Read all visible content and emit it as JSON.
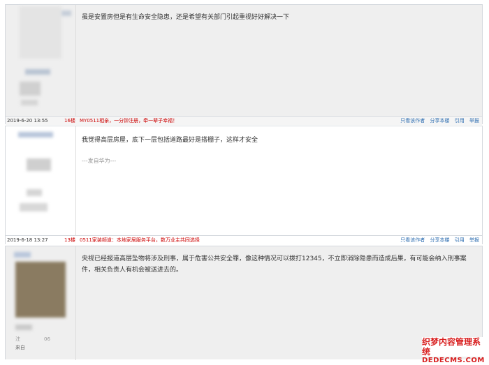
{
  "posts": [
    {
      "text": "虽是安置房但是有生命安全隐患，还是希望有关部门引起重视好好解决一下",
      "date": "2019-6-20 13:55",
      "floor": "16楼",
      "ad": "MY0511相亲，一分钟注册，牵一辈子幸福！",
      "actions": [
        "只看该作者",
        "分享本楼",
        "引用",
        "举报"
      ]
    },
    {
      "text": "我觉得高层房屋，底下一层包括道路最好是搭棚子，这样才安全",
      "via": "---发自华为---",
      "date": "2019-6-18 13:27",
      "floor": "13楼",
      "ad": "0511家装频道：本地家居服务平台，数万业主共同选择",
      "actions": [
        "只看该作者",
        "分享本楼",
        "引用",
        "举报"
      ]
    },
    {
      "text": "央视已经报道高层坠物将涉及刑事，属于危害公共安全罪，像这种情况可以拨打12345，不立即消除隐患而造成后果，有可能会纳入刑事案件，相关负责人有机会被送进去的。",
      "side_text": [
        "注",
        "06",
        "来自"
      ]
    }
  ],
  "watermark": {
    "line1": "织梦内容管理系统",
    "line2": "DEDECMS.COM"
  }
}
